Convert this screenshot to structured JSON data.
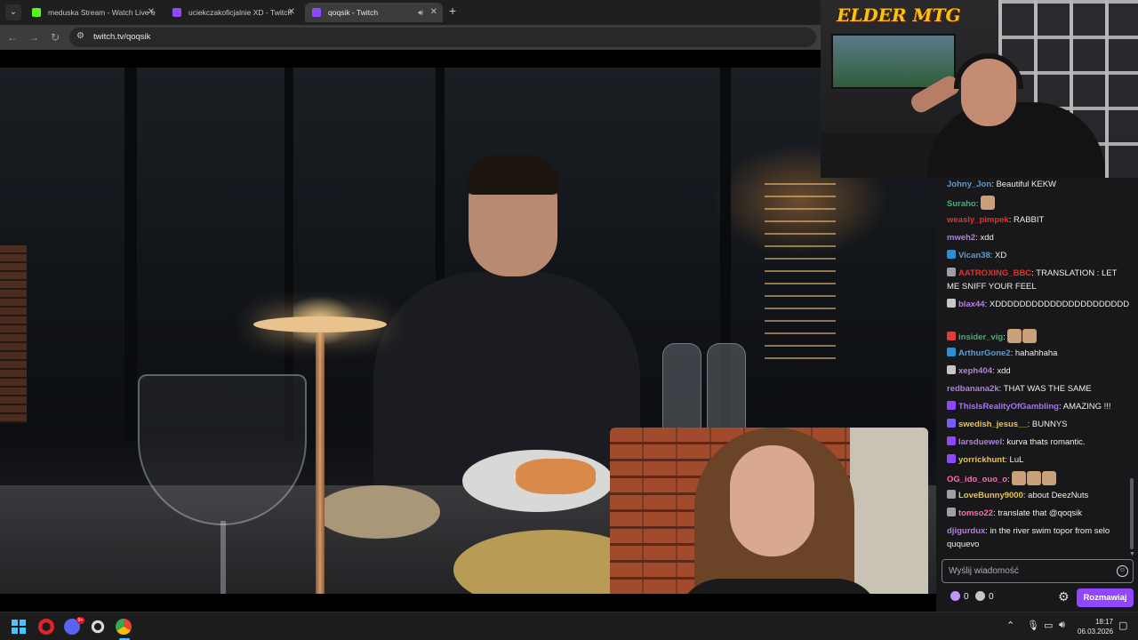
{
  "browser": {
    "tabs": [
      {
        "title": "meduska Stream - Watch Live o",
        "favicon_color": "#53fc18",
        "active": false
      },
      {
        "title": "uciekczakoficjalnie XD - Twitch",
        "favicon_color": "#9147ff",
        "active": false
      },
      {
        "title": "qoqsik - Twitch",
        "favicon_color": "#9147ff",
        "active": true
      }
    ],
    "url": "twitch.tv/qoqsik",
    "icons": [
      "tab-search-icon",
      "back-icon",
      "forward-icon",
      "reload-icon",
      "site-info-icon",
      "speaker-icon",
      "close-icon",
      "new-tab-icon"
    ]
  },
  "webcam": {
    "overlay_logo": "ELDER MTG"
  },
  "chat": {
    "messages": [
      {
        "user": "Johny_Jon",
        "color": "#5b9bd5",
        "text": "Beautiful KEKW",
        "badge": null,
        "emotes": 0
      },
      {
        "user": "Suraho",
        "color": "#3cb371",
        "text": "",
        "badge": null,
        "emotes": 1
      },
      {
        "user": "weasly_pimpek",
        "color": "#e0342b",
        "text": "RABBIT",
        "badge": null,
        "emotes": 0
      },
      {
        "user": "mweh2",
        "color": "#b47ee5",
        "text": "xdd",
        "badge": null,
        "emotes": 0
      },
      {
        "user": "Vican38",
        "color": "#5b9bd5",
        "text": "XD",
        "badge": "#2a8fd8",
        "emotes": 0
      },
      {
        "user": "AATROXING_BBC",
        "color": "#e0342b",
        "text": "TRANSLATION : LET ME SNIFF YOUR FEEL",
        "badge": "#9aa0a6",
        "emotes": 0
      },
      {
        "user": "blax44",
        "color": "#b47ee5",
        "text": "XDDDDDDDDDDDDDDDDDDDDDD",
        "badge": "#c7c7c7",
        "emotes": 0
      },
      {
        "user": "insider_vig",
        "color": "#3cb371",
        "text": "",
        "badge": "#e03b3b",
        "emotes": 2
      },
      {
        "user": "ArthurGone2",
        "color": "#5b9bd5",
        "text": "hahahhaha",
        "badge": "#2a8fd8",
        "emotes": 0
      },
      {
        "user": "xeph404",
        "color": "#b47ee5",
        "text": "xdd",
        "badge": "#c7c7c7",
        "emotes": 0
      },
      {
        "user": "redbanana2k",
        "color": "#b47ee5",
        "text": "THAT WAS THE SAME",
        "badge": null,
        "emotes": 0
      },
      {
        "user": "ThisIsRealityOfGambling",
        "color": "#a970ff",
        "text": "AMAZING !!!",
        "badge": "#9147ff",
        "emotes": 0
      },
      {
        "user": "swedish_jesus__",
        "color": "#e8c547",
        "text": "BUNNYS",
        "badge": "#7a5cff",
        "emotes": 0
      },
      {
        "user": "larsduewel",
        "color": "#b47ee5",
        "text": "kurva thats romantic.",
        "badge": "#9147ff",
        "emotes": 0
      },
      {
        "user": "yorrickhunt",
        "color": "#e8c547",
        "text": "LuL",
        "badge": "#9147ff",
        "emotes": 0
      },
      {
        "user": "OG_ido_ouo_o",
        "color": "#ff69b4",
        "text": "",
        "badge": null,
        "emotes": 3
      },
      {
        "user": "LoveBunny9000",
        "color": "#e8c547",
        "text": "about DeezNuts",
        "badge": "#9aa0a6",
        "emotes": 0
      },
      {
        "user": "tomso22",
        "color": "#ff69b4",
        "text": "translate that @qoqsik",
        "badge": "#9aa0a6",
        "emotes": 0
      },
      {
        "user": "djigurdux",
        "color": "#b47ee5",
        "text": "in the river swim topor from selo ququevo",
        "badge": null,
        "emotes": 0
      }
    ],
    "input_placeholder": "Wyślij wiadomość",
    "points": [
      {
        "icon": "bits-icon",
        "value": "0",
        "color": "#bf94ff"
      },
      {
        "icon": "channel-points-icon",
        "value": "0",
        "color": "#c7c7c7"
      }
    ],
    "send_label": "Rozmawiaj",
    "accent_color": "#9147ff"
  },
  "taskbar": {
    "apps": [
      "start-icon",
      "opera-icon",
      "discord-icon",
      "obs-icon",
      "chrome-icon"
    ],
    "discord_badge": "9+",
    "time": "18:17",
    "date": "06.03.2026"
  }
}
